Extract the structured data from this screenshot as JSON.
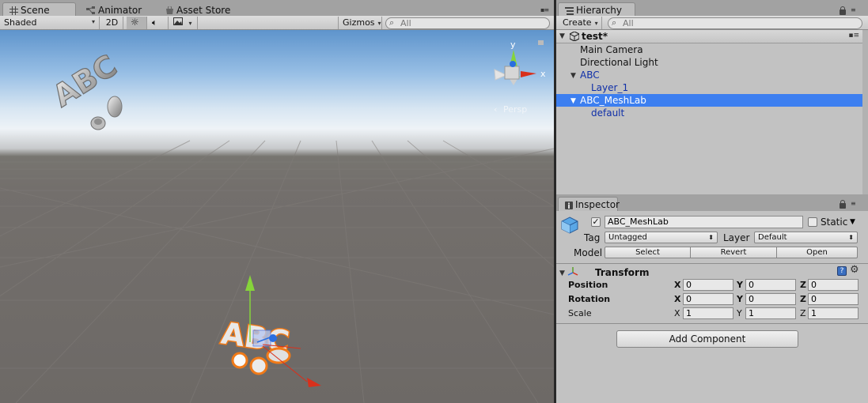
{
  "scene_tabs": {
    "scene": "Scene",
    "animator": "Animator",
    "asset_store": "Asset Store"
  },
  "scene_toolbar": {
    "shading_mode": "Shaded",
    "mode_2d": "2D",
    "gizmos": "Gizmos",
    "search_placeholder": "All"
  },
  "scene_view": {
    "projection_label": "Persp",
    "gizmo_axes": {
      "y": "y",
      "x": "x"
    },
    "sky_text": "ABC",
    "object_text": "ABC"
  },
  "hierarchy": {
    "tab_label": "Hierarchy",
    "create_label": "Create",
    "search_placeholder": "All",
    "scene_name": "test*",
    "items": [
      {
        "label": "Main Camera"
      },
      {
        "label": "Directional Light"
      },
      {
        "label": "ABC"
      },
      {
        "label": "Layer_1"
      },
      {
        "label": "ABC_MeshLab"
      },
      {
        "label": "default"
      }
    ]
  },
  "inspector": {
    "tab_label": "Inspector",
    "object_name": "ABC_MeshLab",
    "static_label": "Static",
    "tag_label": "Tag",
    "tag_value": "Untagged",
    "layer_label": "Layer",
    "layer_value": "Default",
    "model_label": "Model",
    "model_buttons": {
      "select": "Select",
      "revert": "Revert",
      "open": "Open"
    },
    "transform": {
      "title": "Transform",
      "rows": [
        {
          "label": "Position",
          "x": "0",
          "y": "0",
          "z": "0"
        },
        {
          "label": "Rotation",
          "x": "0",
          "y": "0",
          "z": "0"
        },
        {
          "label": "Scale",
          "x": "1",
          "y": "1",
          "z": "1"
        }
      ],
      "axis_labels": {
        "x": "X",
        "y": "Y",
        "z": "Z"
      }
    },
    "add_component": "Add Component"
  },
  "colors": {
    "selection": "#3d7ff0",
    "prefab_text": "#0f2fa8",
    "outline_orange": "#f07a18",
    "axis_x": "#d8301c",
    "axis_y": "#86d43a",
    "axis_z": "#2a6ee0"
  }
}
